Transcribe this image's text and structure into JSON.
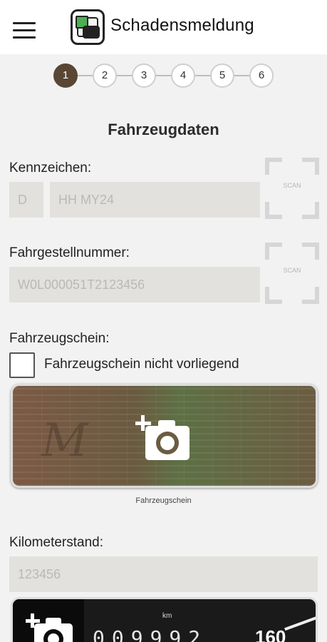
{
  "appbar": {
    "title": "Schadensmeldung",
    "menu_icon": "hamburger-menu-icon",
    "app_icon": "car-damage-app-icon"
  },
  "steps": {
    "items": [
      "1",
      "2",
      "3",
      "4",
      "5",
      "6"
    ],
    "active": "1",
    "active_color": "#5a4634"
  },
  "section": {
    "title": "Fahrzeugdaten"
  },
  "plate": {
    "label": "Kennzeichen:",
    "prefix_placeholder": "D",
    "number_placeholder": "HH MY24",
    "scan_label": "SCAN"
  },
  "vin": {
    "label": "Fahrgestellnummer:",
    "placeholder": "W0L000051T2123456",
    "scan_label": "SCAN"
  },
  "registration": {
    "label": "Fahrzeugschein:",
    "not_available_label": "Fahrzeugschein nicht vorliegend",
    "not_available_checked": false,
    "photo_caption": "Fahrzeugschein",
    "camera_icon": "add-photo-camera-icon"
  },
  "mileage": {
    "label": "Kilometerstand:",
    "placeholder": "123456",
    "odometer_digits": "009992",
    "odometer_unit": "km",
    "speed_mark": "160",
    "camera_icon": "add-photo-camera-icon"
  }
}
